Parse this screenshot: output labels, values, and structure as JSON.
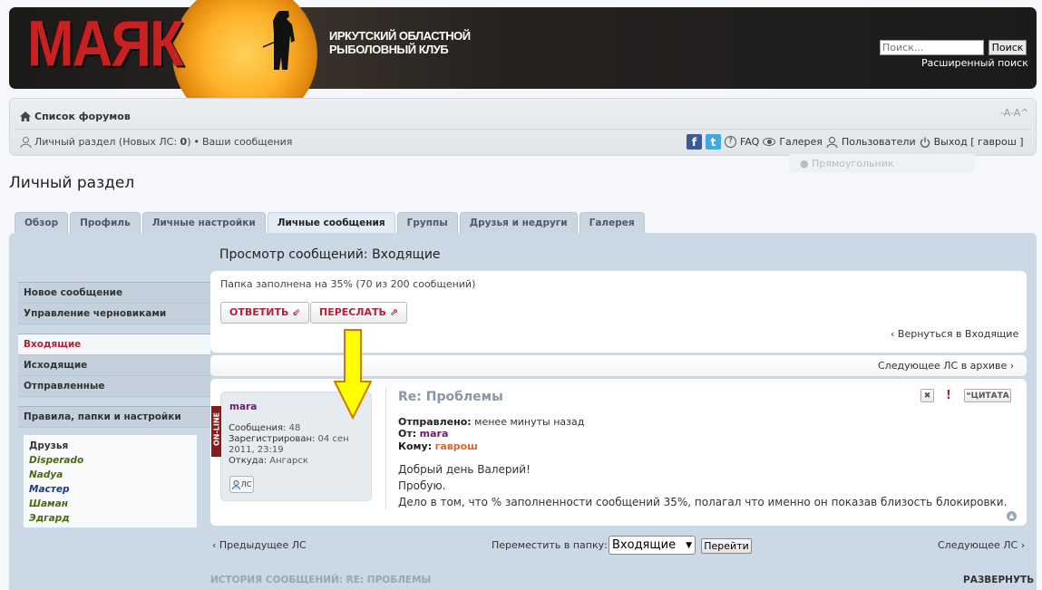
{
  "header": {
    "logo": "МАЯК",
    "club_line1": "ИРКУТСКИЙ ОБЛАСТНОЙ",
    "club_line2": "РЫБОЛОВНЫЙ КЛУБ",
    "search_placeholder": "Поиск...",
    "search_button": "Поиск",
    "advanced_search": "Расширенный поиск"
  },
  "navbar": {
    "home_icon": "home-icon",
    "forum_list": "Список форумов",
    "font_size_control": "-A-A^",
    "pm_section": "Личный раздел (Новых ЛС: ",
    "pm_new_count": "0",
    "pm_section_end": ")",
    "bullet": "•",
    "your_messages": "Ваши сообщения",
    "facebook": "f",
    "twitter": "t",
    "faq": "FAQ",
    "gallery": "Галерея",
    "users": "Пользователи",
    "logout": "Выход [ гаврош ]",
    "ghost_text": "Прямоугольник"
  },
  "page_title": "Личный раздел",
  "tabs": [
    {
      "label": "Обзор"
    },
    {
      "label": "Профиль"
    },
    {
      "label": "Личные настройки"
    },
    {
      "label": "Личные сообщения"
    },
    {
      "label": "Группы"
    },
    {
      "label": "Друзья и недруги"
    },
    {
      "label": "Галерея"
    }
  ],
  "content_title": "Просмотр сообщений: Входящие",
  "menu": {
    "new_message": "Новое сообщение",
    "drafts": "Управление черновиками",
    "inbox": "Входящие",
    "outbox": "Исходящие",
    "sent": "Отправленные",
    "rules": "Правила, папки и настройки"
  },
  "friends": {
    "header": "Друзья",
    "list": [
      {
        "name": "Disperado",
        "color": "#4a6b10"
      },
      {
        "name": "Nadya",
        "color": "#4a6b10"
      },
      {
        "name": "Мастер",
        "color": "#1a3a8a"
      },
      {
        "name": "Шаман",
        "color": "#4a6b10"
      },
      {
        "name": "Эдгард",
        "color": "#4a6b10"
      }
    ]
  },
  "toolbar": {
    "folder_fill": "Папка заполнена на 35% (70 из 200 сообщений)",
    "reply": "ОТВЕТИТЬ ⇙",
    "forward": "ПЕРЕСЛАТЬ ⇗",
    "back_inbox": "‹ Вернуться в Входящие",
    "next_archive": "Следующее ЛС в архиве ›"
  },
  "post": {
    "online": "ON-LINE",
    "author": "mara",
    "messages_label": "Сообщения:",
    "messages_value": "48",
    "registered_label": "Зарегистрирован:",
    "registered_value_1": "04 сен",
    "registered_value_2": "2011, 23:19",
    "from_label": "Откуда:",
    "from_value": "Ангарск",
    "pm_button": "ЛС",
    "title": "Re: Проблемы",
    "sent_label": "Отправлено:",
    "sent_value": "менее минуты назад",
    "from_user_label": "От:",
    "from_user": "mara",
    "to_label": "Кому:",
    "to_user": "гаврош",
    "body": [
      "Добрый день Валерий!",
      "Пробую.",
      "Дело в том, что % заполненности сообщений 35%, полагал что именно он показав близость блокировки."
    ],
    "delete_icon": "✖",
    "report_icon": "!",
    "quote_button": "❝ЦИТАТА",
    "top_icon": "▲"
  },
  "bottom": {
    "prev": "‹ Предыдущее ЛС",
    "move_label": "Переместить в папку:",
    "folder_selected": "Входящие",
    "go": "Перейти",
    "next": "Следующее ЛС ›",
    "history": "ИСТОРИЯ СООБЩЕНИЙ: RE: ПРОБЛЕМЫ",
    "expand": "РАЗВЕРНУТЬ"
  },
  "annotation_arrow_color": "#ffff00"
}
